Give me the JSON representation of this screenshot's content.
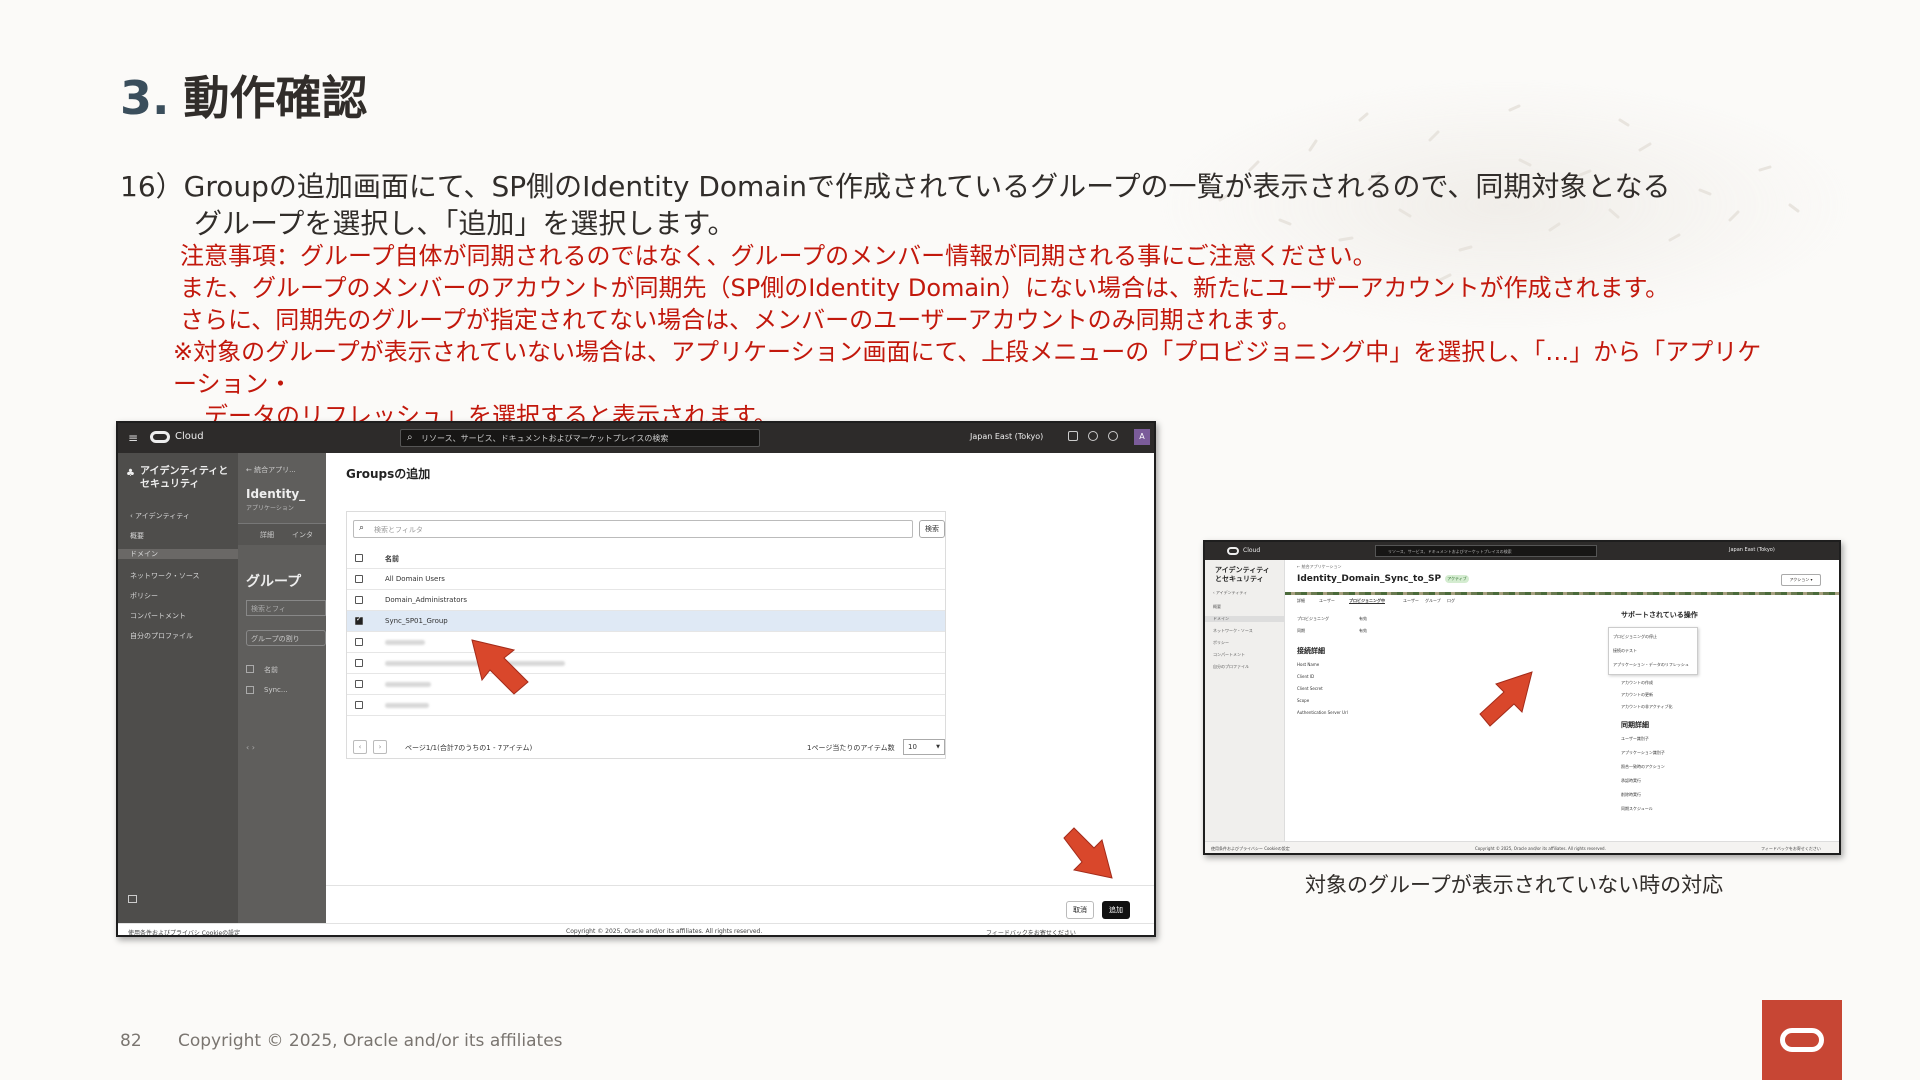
{
  "slide": {
    "title_num": "3.",
    "title": "動作確認",
    "step_line1": "16）Groupの追加画面にて、SP側のIdentity  Domainで作成されているグループの一覧が表示されるので、同期対象となる",
    "step_line2": "グループを選択し、「追加」を選択します。",
    "note1": "注意事項：グループ自体が同期されるのではなく、グループのメンバー情報が同期される事にご注意ください。",
    "note2": "また、グループのメンバーのアカウントが同期先（SP側のIdentity Domain）にない場合は、新たにユーザーアカウントが作成されます。",
    "note3": "さらに、同期先のグループが指定されてない場合は、メンバーのユーザーアカウントのみ同期されます。",
    "note4": "※対象のグループが表示されていない場合は、アプリケーション画面にて、上段メニューの「プロビジョニング中」を選択し、「…」から「アプリケーション・",
    "note5": "データのリフレッシュ」を選択すると表示されます。",
    "caption": "対象のグループが表示されていない時の対応",
    "page_number": "82",
    "copyright": "Copyright © 2025, Oracle and/or its affiliates"
  },
  "shot1": {
    "menu_icon": "≡",
    "brand": "Cloud",
    "search_placeholder": "リソース、サービス、ドキュメントおよびマーケットプレイスの検索",
    "region": "Japan East (Tokyo)",
    "avatar": "A",
    "sidebar": {
      "heading": "アイデンティティとセキュリティ",
      "back": "‹  アイデンティティ",
      "items": [
        "概要",
        "ドメイン",
        "ネットワーク・ソース",
        "ポリシー",
        "コンパートメント",
        "自分のプロファイル"
      ]
    },
    "mid": {
      "crumb": "← 統合アプリ...",
      "title": "Identity_",
      "subtitle": "アプリケーション",
      "tab1": "詳細",
      "tab2": "インタ",
      "groups_heading": "グループ",
      "search_ph": "検索とフィ",
      "btn": "グループの割り",
      "col": "名前",
      "row": "Sync..."
    },
    "panel": {
      "title": "Groupsの追加",
      "search_placeholder": "検索とフィルタ",
      "search_button": "検索",
      "column_name": "名前",
      "rows": [
        "All Domain Users",
        "Domain_Administrators",
        "Sync_SP01_Group"
      ],
      "pager_text": "ページ1/1(合計7のうちの1 - 7アイテム)",
      "per_page_label": "1ページ当たりのアイテム数",
      "per_page_value": "10",
      "prev": "‹",
      "next": "›",
      "cancel": "取消",
      "add": "追加"
    },
    "bottom": {
      "left": "使用条件およびプライバシ    Cookieの設定",
      "center": "Copyright © 2025, Oracle and/or its affiliates. All rights reserved.",
      "right": "フィードバックをお寄せください"
    }
  },
  "shot2": {
    "brand": "Cloud",
    "search_placeholder": "リソース、サービス、ドキュメントおよびマーケットプレイスの検索",
    "region": "Japan East (Tokyo)",
    "sidebar_heading": "アイデンティティとセキュリティ",
    "sidebar_items": [
      "‹ アイデンティティ",
      "概要",
      "ドメイン",
      "ネットワーク・ソース",
      "ポリシー",
      "コンパートメント",
      "自分のプロファイル"
    ],
    "crumb": "← 統合アプリケーション",
    "title": "Identity_Domain_Sync_to_SP",
    "badge": "アクティブ",
    "actions": "アクション ▾",
    "tabs": [
      "詳細",
      "ユーザー",
      "プロビジョニング中",
      "ユーザー",
      "グループ",
      "ログ"
    ],
    "labels": [
      "プロビジョニング",
      "有効",
      "同期",
      "有効"
    ],
    "conn_heading": "接続詳細",
    "conn_labels": [
      "Host Name",
      "Client ID",
      "Client Secret",
      "Scope",
      "Authentication Server Url"
    ],
    "support_heading": "サポートされている操作",
    "popup_items": [
      "プロビジョニングの停止",
      "接続のテスト",
      "アプリケーション・データのリフレッシュ"
    ],
    "support_labels": [
      "アカウントの作成",
      "アカウントの更新",
      "アカウントの非アクティブ化",
      "アカウントの削除"
    ],
    "sync_heading": "同期詳細",
    "sync_labels": [
      "ユーザー識別子",
      "アプリケーション識別子",
      "照合一致時のアクション",
      "承認時実行",
      "削除時実行",
      "同期スケジュール"
    ],
    "bottom_left": "使用条件およびプライバシー    Cookieの設定",
    "bottom_center": "Copyright © 2025, Oracle and/or its affiliates. All rights reserved.",
    "bottom_right": "フィードバックをお寄せください"
  },
  "colors": {
    "accent_red": "#c2180c",
    "oracle_red": "#c74634",
    "arrow_red": "#d9472b"
  }
}
